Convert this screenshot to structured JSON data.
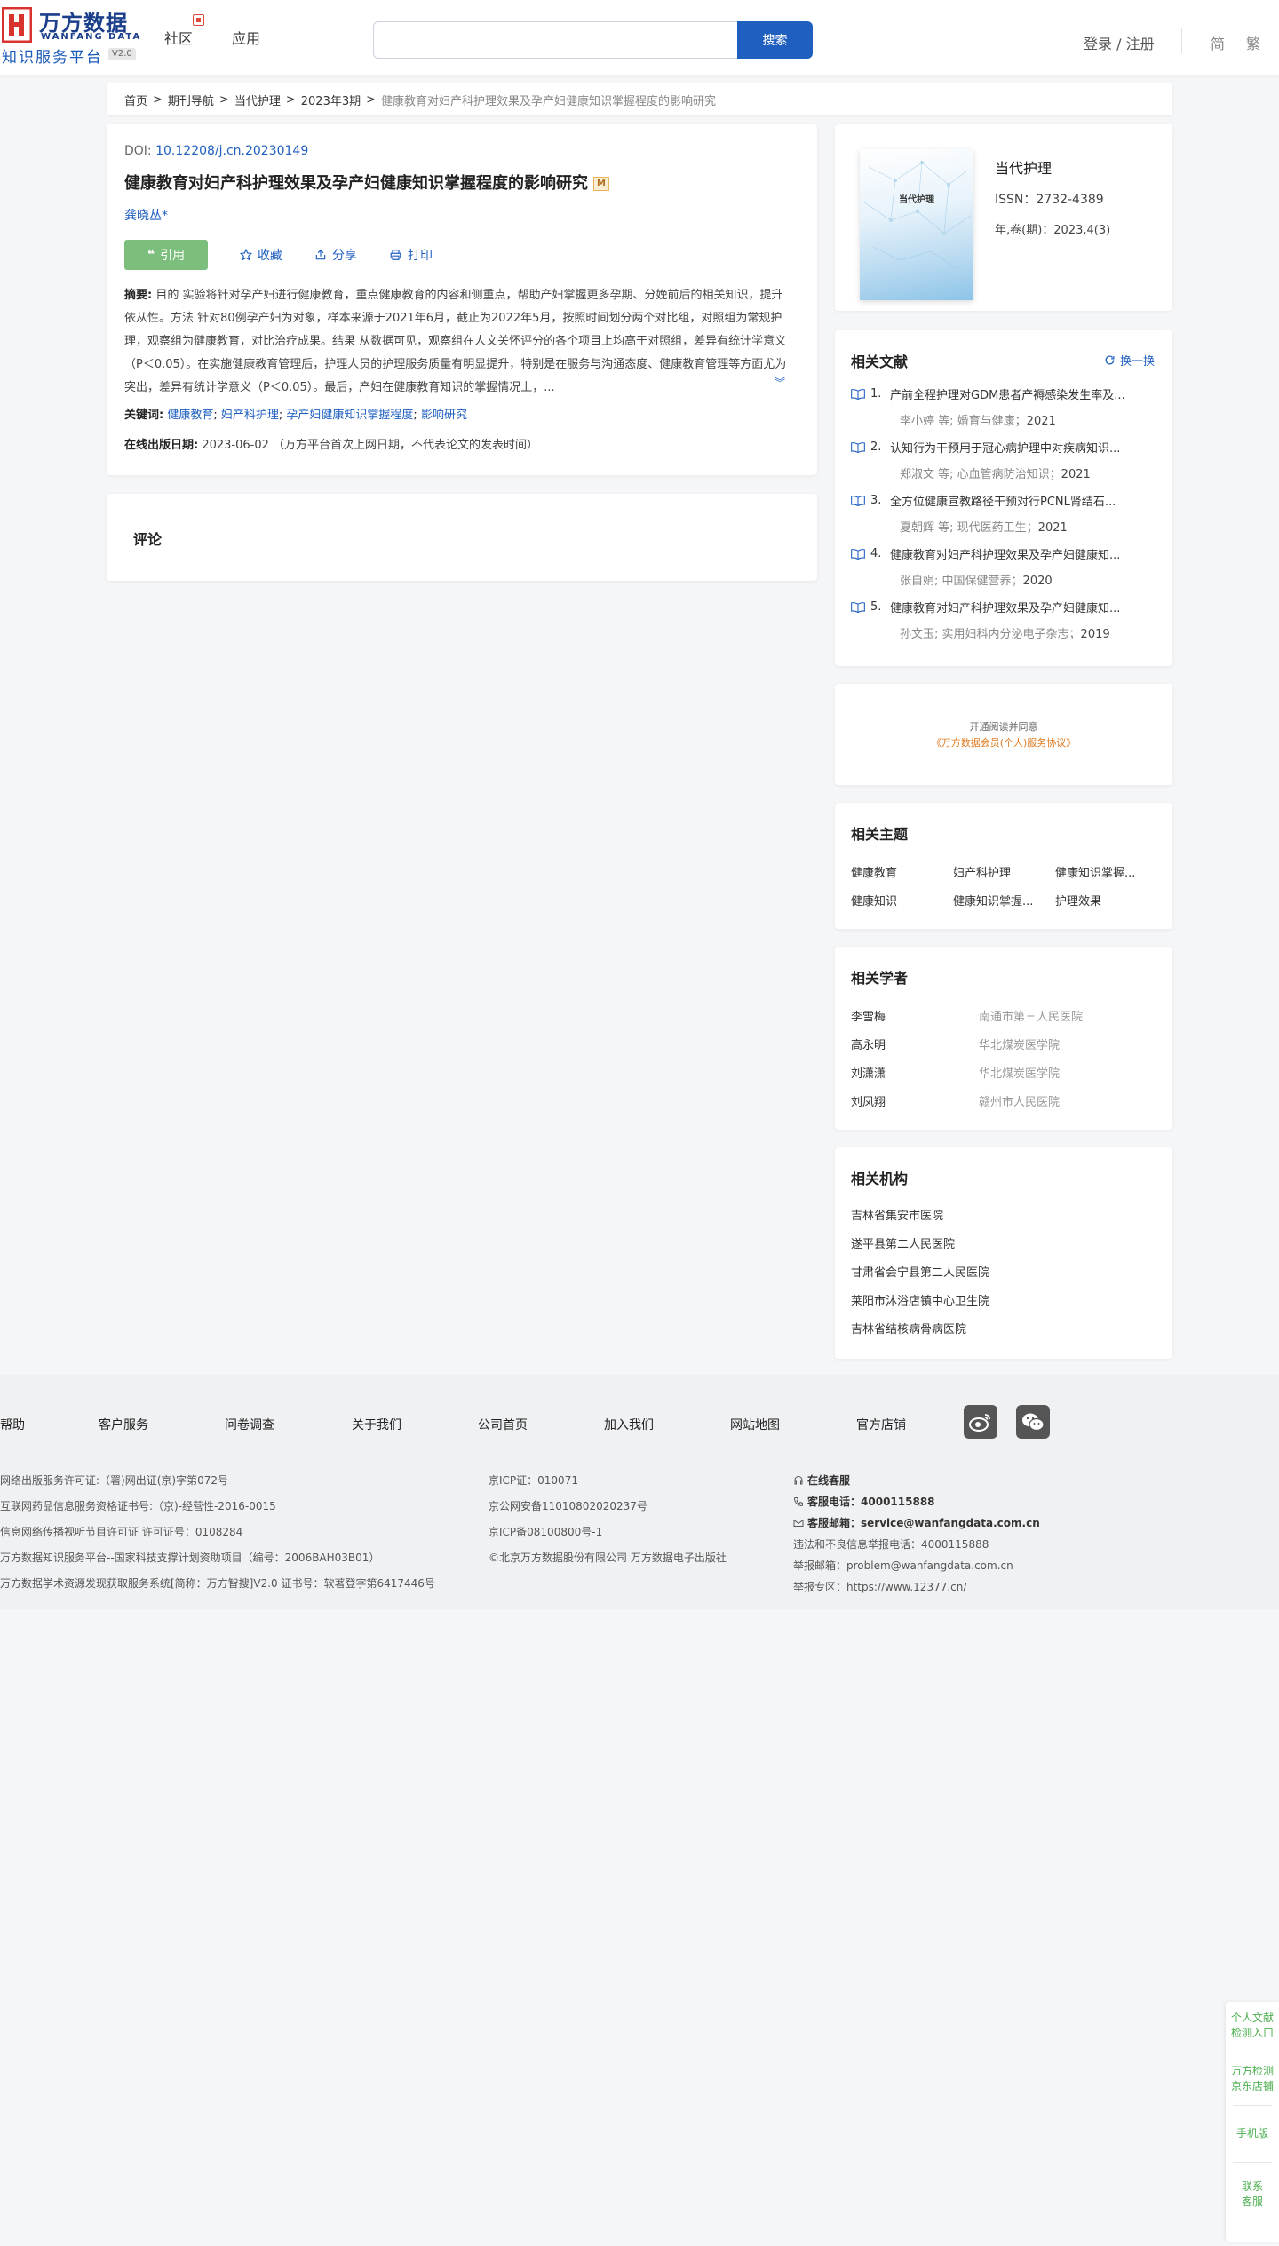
{
  "header": {
    "logo_cn": "万方数据",
    "logo_en": "WANFANG DATA",
    "platform": "知识服务平台",
    "version": "V2.0",
    "nav": [
      "社区",
      "应用"
    ],
    "search_placeholder": "",
    "search_button": "搜索",
    "login": "登录 / 注册",
    "lang_simplified": "简",
    "lang_traditional": "繁"
  },
  "breadcrumb": {
    "items": [
      "首页",
      "期刊导航",
      "当代护理",
      "2023年3期"
    ],
    "separator": ">",
    "current": "健康教育对妇产科护理效果及孕产妇健康知识掌握程度的影响研究"
  },
  "article": {
    "doi_label": "DOI:",
    "doi": "10.12208/j.cn.20230149",
    "title": "健康教育对妇产科护理效果及孕产妇健康知识掌握程度的影响研究",
    "m_badge": "M",
    "author": "龚晓丛*",
    "actions": {
      "cite": "引用",
      "favorite": "收藏",
      "share": "分享",
      "print": "打印"
    },
    "abstract_label": "摘要:",
    "abstract": "目的 实验将针对孕产妇进行健康教育，重点健康教育的内容和侧重点，帮助产妇掌握更多孕期、分娩前后的相关知识，提升依从性。方法 针对80例孕产妇为对象，样本来源于2021年6月，截止为2022年5月，按照时间划分两个对比组，对照组为常规护理，观察组为健康教育，对比治疗成果。结果 从数据可见，观察组在人文关怀评分的各个项目上均高于对照组，差异有统计学意义（P＜0.05）。在实施健康教育管理后，护理人员的护理服务质量有明显提升，特别是在服务与沟通态度、健康教育管理等方面尤为突出，差异有统计学意义（P＜0.05）。最后，产妇在健康教育知识的掌握情况上，...",
    "keywords_label": "关键词:",
    "keywords": [
      "健康教育",
      "妇产科护理",
      "孕产妇健康知识掌握程度",
      "影响研究"
    ],
    "pubdate_label": "在线出版日期:",
    "pubdate": "2023-06-02",
    "pubdate_note": "（万方平台首次上网日期，不代表论文的发表时间）"
  },
  "comments": {
    "title": "评论"
  },
  "journal": {
    "cover_title": "当代护理",
    "name": "当代护理",
    "issn": "ISSN：2732-4389",
    "volume": "年,卷(期)：2023,4(3)"
  },
  "related_literature": {
    "title": "相关文献",
    "refresh": "换一换",
    "items": [
      {
        "num": "1.",
        "title": "产前全程护理对GDM患者产褥感染发生率及...",
        "authors": "李小婷  等;",
        "source": "婚育与健康；",
        "year": "2021"
      },
      {
        "num": "2.",
        "title": "认知行为干预用于冠心病护理中对疾病知识...",
        "authors": "郑淑文  等;",
        "source": "心血管病防治知识；",
        "year": "2021"
      },
      {
        "num": "3.",
        "title": "全方位健康宣教路径干预对行PCNL肾结石...",
        "authors": "夏朝辉  等;",
        "source": "现代医药卫生；",
        "year": "2021"
      },
      {
        "num": "4.",
        "title": "健康教育对妇产科护理效果及孕产妇健康知...",
        "authors": "张自娟;",
        "source": "中国保健营养；",
        "year": "2020"
      },
      {
        "num": "5.",
        "title": "健康教育对妇产科护理效果及孕产妇健康知...",
        "authors": "孙文玉;",
        "source": "实用妇科内分泌电子杂志；",
        "year": "2019"
      }
    ]
  },
  "agreement": {
    "line1": "开通阅读并同意",
    "line2": "《万方数据会员(个人)服务协议》"
  },
  "related_topics": {
    "title": "相关主题",
    "items": [
      "健康教育",
      "妇产科护理",
      "健康知识掌握...",
      "健康知识",
      "健康知识掌握...",
      "护理效果"
    ]
  },
  "related_scholars": {
    "title": "相关学者",
    "items": [
      {
        "name": "李雪梅",
        "org": "南通市第三人民医院"
      },
      {
        "name": "高永明",
        "org": "华北煤炭医学院"
      },
      {
        "name": "刘潇潇",
        "org": "华北煤炭医学院"
      },
      {
        "name": "刘凤翔",
        "org": "赣州市人民医院"
      }
    ]
  },
  "related_orgs": {
    "title": "相关机构",
    "items": [
      "吉林省集安市医院",
      "遂平县第二人民医院",
      "甘肃省会宁县第二人民医院",
      "莱阳市沐浴店镇中心卫生院",
      "吉林省结核病骨病医院"
    ]
  },
  "footer": {
    "links": [
      "帮助",
      "客户服务",
      "问卷调查",
      "关于我们",
      "公司首页",
      "加入我们",
      "网站地图",
      "官方店铺"
    ],
    "col1": [
      "网络出版服务许可证:（署)网出证(京)字第072号",
      "互联网药品信息服务资格证书号:（京)-经营性-2016-0015",
      "信息网络传播视听节目许可证 许可证号：0108284",
      "万方数据知识服务平台--国家科技支撑计划资助项目（编号：2006BAH03B01）",
      "万方数据学术资源发现获取服务系统[简称：万方智搜]V2.0 证书号：软著登字第6417446号"
    ],
    "col2": [
      "京ICP证：010071",
      "京公网安备11010802020237号",
      "京ICP备08100800号-1",
      "©北京万方数据股份有限公司 万方数据电子出版社"
    ],
    "online_service": "在线客服",
    "phone_label": "客服电话：",
    "phone": "4000115888",
    "email_label": "客服邮箱：",
    "email": "service@wanfangdata.com.cn",
    "report_phone": "违法和不良信息举报电话：4000115888",
    "report_email": "举报邮箱：problem@wanfangdata.com.cn",
    "report_zone": "举报专区：https://www.12377.cn/"
  },
  "side_panel": {
    "items": [
      "个人文献\n检测入口",
      "万方检测\n京东店铺",
      "手机版",
      "联系\n客服"
    ]
  },
  "colors": {
    "brand_blue": "#1f5fc0",
    "logo_red": "#d9332f",
    "cite_green": "#7cbf7c",
    "agreement_orange": "#e07a20",
    "side_green": "#4caf50"
  }
}
